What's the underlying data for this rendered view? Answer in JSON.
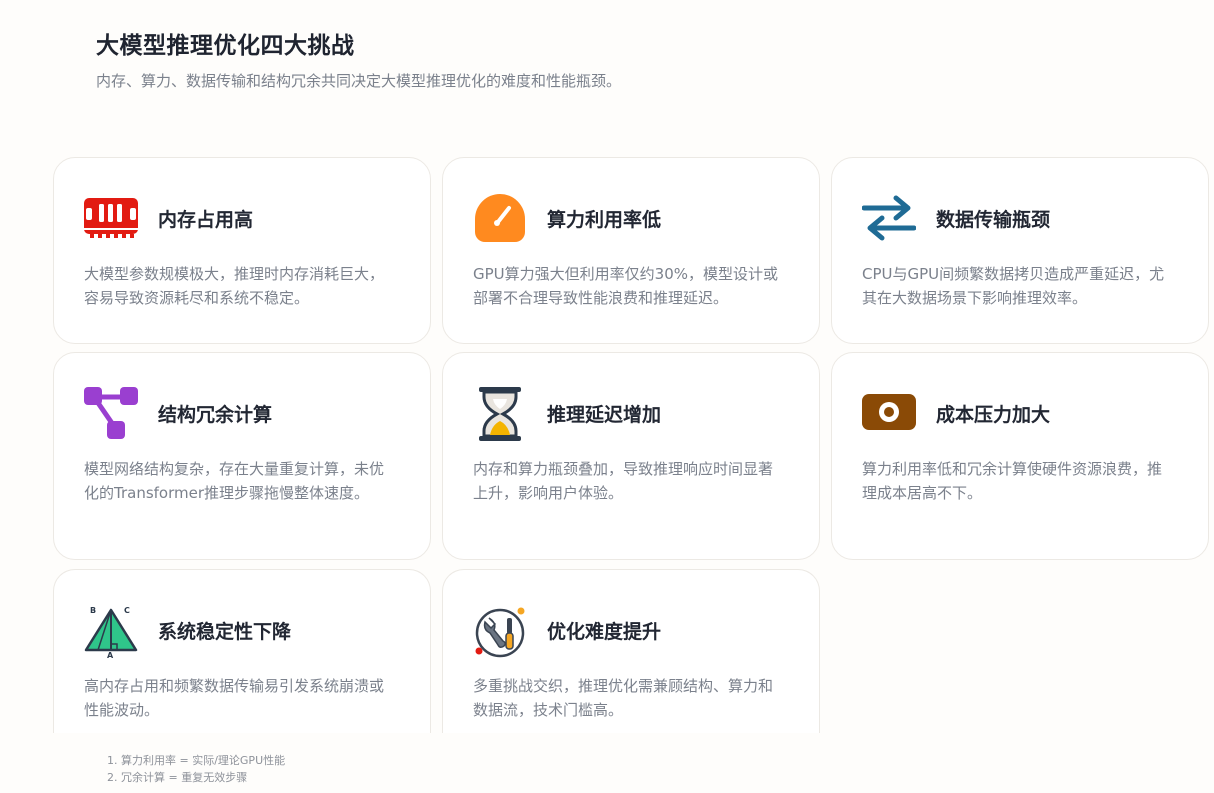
{
  "page": {
    "title": "大模型推理优化四大挑战",
    "subtitle": "内存、算力、数据传输和结构冗余共同决定大模型推理优化的难度和性能瓶颈。"
  },
  "cards": [
    {
      "title": "内存占用高",
      "desc": "大模型参数规模极大，推理时内存消耗巨大，容易导致资源耗尽和系统不稳定。",
      "icon": "memory-icon",
      "color": "#e21b12"
    },
    {
      "title": "算力利用率低",
      "desc": "GPU算力强大但利用率仅约30%，模型设计或部署不合理导致性能浪费和推理延迟。",
      "icon": "gauge-icon",
      "color": "#ff8a1f"
    },
    {
      "title": "数据传输瓶颈",
      "desc": "CPU与GPU间频繁数据拷贝造成严重延迟，尤其在大数据场景下影响推理效率。",
      "icon": "transfer-arrows-icon",
      "color": "#1f6b95"
    },
    {
      "title": "结构冗余计算",
      "desc": "模型网络结构复杂，存在大量重复计算，未优化的Transformer推理步骤拖慢整体速度。",
      "icon": "network-nodes-icon",
      "color": "#9a3fd0"
    },
    {
      "title": "推理延迟增加",
      "desc": "内存和算力瓶颈叠加，导致推理响应时间显著上升，影响用户体验。",
      "icon": "hourglass-icon",
      "color": "#2c3a4b"
    },
    {
      "title": "成本压力加大",
      "desc": "算力利用率低和冗余计算使硬件资源浪费，推理成本居高不下。",
      "icon": "money-icon",
      "color": "#8a4a06"
    },
    {
      "title": "系统稳定性下降",
      "desc": "高内存占用和频繁数据传输易引发系统崩溃或性能波动。",
      "icon": "triangle-geometry-icon",
      "color": "#2fc58a"
    },
    {
      "title": "优化难度提升",
      "desc": "多重挑战交织，推理优化需兼顾结构、算力和数据流，技术门槛高。",
      "icon": "tools-icon",
      "color": "#3a4452"
    }
  ],
  "notes": [
    "1. 算力利用率 = 实际/理论GPU性能",
    "2. 冗余计算 = 重复无效步骤"
  ]
}
